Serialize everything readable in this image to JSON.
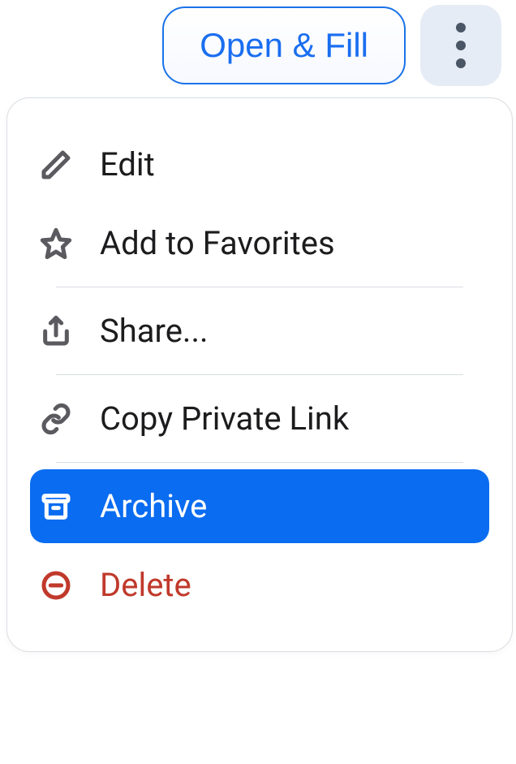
{
  "toolbar": {
    "open_fill_label": "Open & Fill"
  },
  "menu": {
    "edit": "Edit",
    "favorites": "Add to Favorites",
    "share": "Share...",
    "copy_link": "Copy Private Link",
    "archive": "Archive",
    "delete": "Delete"
  }
}
